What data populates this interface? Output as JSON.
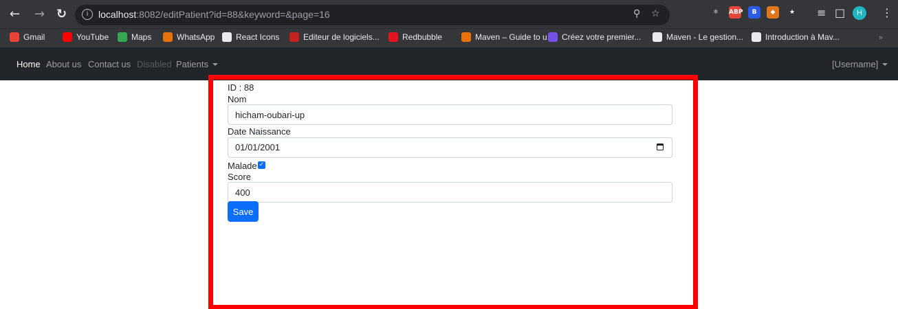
{
  "browser": {
    "url_host": "localhost",
    "url_rest": ":8082/editPatient?id=88&keyword=&page=16",
    "profile_initial": "H",
    "extensions": [
      {
        "name": "react-devtools-icon",
        "label": "⚛",
        "color": "#35363a"
      },
      {
        "name": "adblock-plus-icon",
        "label": "ABP",
        "color": "#e2463c"
      },
      {
        "name": "bootstrap-icon",
        "label": "B",
        "color": "#2b5ce6"
      },
      {
        "name": "metamask-icon",
        "label": "◆",
        "color": "#e2761b"
      },
      {
        "name": "extensions-puzzle-icon",
        "label": "★",
        "color": "#35363a"
      }
    ]
  },
  "bookmarks": [
    {
      "label": "Gmail",
      "icon": "gmail-icon",
      "color": "#ea4335"
    },
    {
      "label": "YouTube",
      "icon": "youtube-icon",
      "color": "#ff0000"
    },
    {
      "label": "Maps",
      "icon": "maps-icon",
      "color": "#34a853"
    },
    {
      "label": "WhatsApp",
      "icon": "whatsapp-icon",
      "color": "#e8710a"
    },
    {
      "label": "React Icons",
      "icon": "globe-icon",
      "color": "#e8eaed"
    },
    {
      "label": "Editeur de logiciels...",
      "icon": "editeur-icon",
      "color": "#c5221f"
    },
    {
      "label": "Redbubble",
      "icon": "redbubble-icon",
      "color": "#e41321"
    },
    {
      "label": "Maven – Guide to u...",
      "icon": "maven-icon",
      "color": "#e8710a"
    },
    {
      "label": "Créez votre premier...",
      "icon": "openclassrooms-icon",
      "color": "#7451eb"
    },
    {
      "label": "Maven - Le gestion...",
      "icon": "developpez-icon",
      "color": "#e8eaed"
    },
    {
      "label": "Introduction à Mav...",
      "icon": "globe-icon",
      "color": "#e8eaed"
    }
  ],
  "navbar": {
    "home": "Home",
    "about": "About us",
    "contact": "Contact us",
    "disabled": "Disabled",
    "patients": "Patients",
    "username": "[Username]"
  },
  "form": {
    "id_label": "ID : 88",
    "nom_label": "Nom",
    "nom_value": "hicham-oubari-up",
    "date_label": "Date Naissance",
    "date_value": "01/01/2001",
    "malade_label": "Malade",
    "malade_checked": true,
    "score_label": "Score",
    "score_value": "400",
    "save_label": "Save"
  },
  "colors": {
    "highlight": "#ff0000",
    "primary": "#0d6efd",
    "navbar_bg": "#212529"
  }
}
